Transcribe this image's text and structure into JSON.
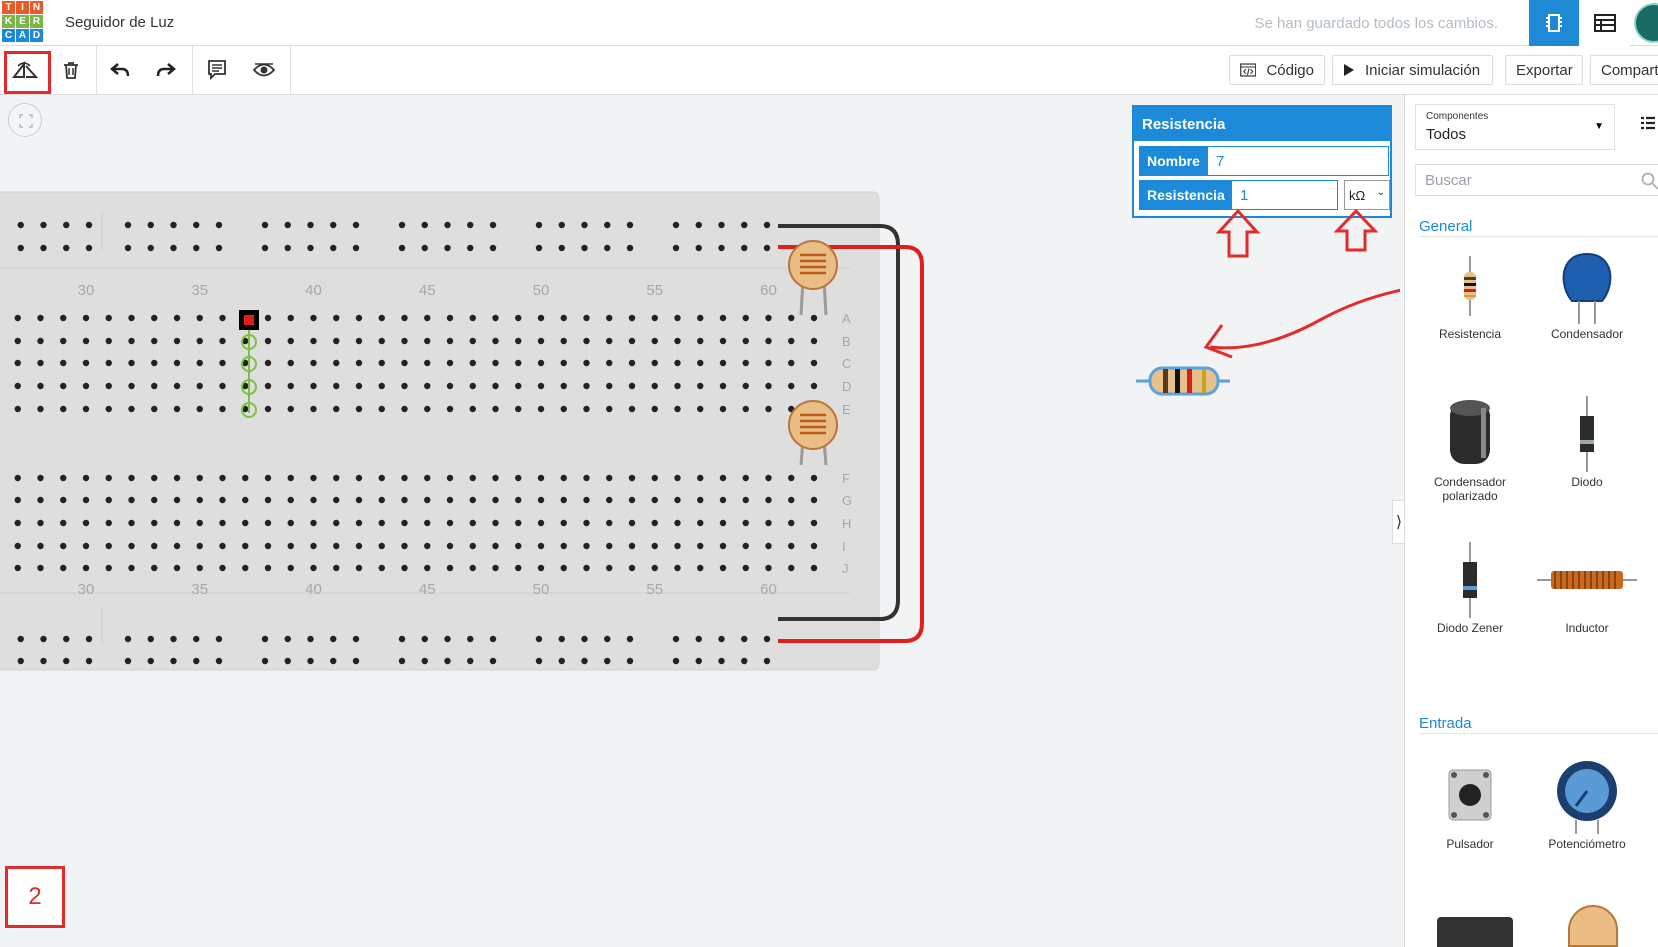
{
  "app": {
    "logo_letters": [
      "T",
      "I",
      "N",
      "K",
      "E",
      "R",
      "C",
      "A",
      "D"
    ],
    "logo_colors": [
      "#e85a27",
      "#e85a27",
      "#e85a27",
      "#7ab648",
      "#7ab648",
      "#7ab648",
      "#1c8ad9",
      "#1c8ad9",
      "#1c8ad9"
    ],
    "title": "Seguidor de Luz",
    "save_status": "Se han guardado todos los cambios."
  },
  "toolbar": {
    "code_label": "Código",
    "simulate_label": "Iniciar simulación",
    "export_label": "Exportar",
    "share_label": "Compartir"
  },
  "inspector": {
    "title": "Resistencia",
    "name_label": "Nombre",
    "name_value": "7",
    "resistance_label": "Resistencia",
    "resistance_value": "1",
    "unit": "kΩ"
  },
  "breadboard": {
    "column_numbers": [
      "30",
      "35",
      "40",
      "45",
      "50",
      "55",
      "60"
    ],
    "row_letters_top": [
      "A",
      "B",
      "C",
      "D",
      "E"
    ],
    "row_letters_bottom": [
      "F",
      "G",
      "H",
      "I",
      "J"
    ]
  },
  "sidebar": {
    "components_small_label": "Componentes",
    "components_value": "Todos",
    "search_placeholder": "Buscar",
    "categories": [
      {
        "title": "General",
        "items": [
          {
            "label": "Resistencia"
          },
          {
            "label": "Condensador"
          },
          {
            "label": "Condensador polarizado"
          },
          {
            "label": "Diodo"
          },
          {
            "label": "Diodo Zener"
          },
          {
            "label": "Inductor"
          }
        ]
      },
      {
        "title": "Entrada",
        "items": [
          {
            "label": "Pulsador"
          },
          {
            "label": "Potenciómetro"
          }
        ]
      }
    ]
  },
  "annotation": {
    "step_number": "2"
  },
  "colors": {
    "accent": "#1c8ad9",
    "annotation_red": "#e32b2b",
    "wire_black": "#333333",
    "wire_red": "#e01e1e"
  }
}
